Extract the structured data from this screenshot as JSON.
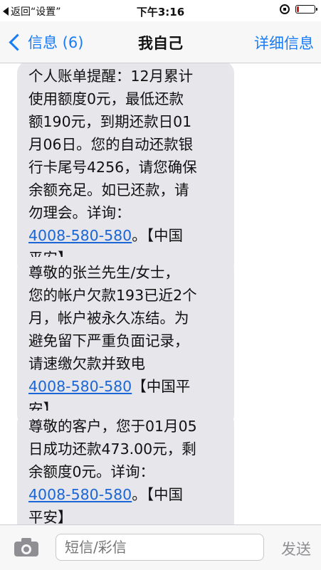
{
  "status_bar": {
    "back_label": "返回“设置”",
    "time": "下午3:16"
  },
  "nav": {
    "back_label": "信息 (6)",
    "title": "我自己",
    "detail_label": "详细信息"
  },
  "messages": [
    {
      "lines": [
        "个人账单提醒：12月累计",
        "使用额度0元，最低还款",
        "额190元，到期还款日01",
        "月06日。您的自动还款银",
        "行卡尾号4256，请您确保",
        "余额充足。如已还款，请",
        "勿理会。详询："
      ],
      "link": "4008-580-580",
      "link_suffix": "。【中国",
      "tail": "平安】"
    },
    {
      "lines": [
        "尊敬的张兰先生/女士，",
        "您的帐户欠款193已近2个",
        "月，帐户被永久冻结。为",
        "避免留下严重负面记录，",
        "请速缴欠款并致电"
      ],
      "link": "4008-580-580",
      "link_suffix": "【中国平",
      "tail": "安】"
    },
    {
      "lines": [
        "尊敬的客户，您于01月05",
        "日成功还款473.00元，剩",
        "余额度0元。详询："
      ],
      "link": "4008-580-580",
      "link_suffix": "。【中国",
      "tail": "平安】"
    }
  ],
  "input_bar": {
    "placeholder": "短信/彩信",
    "send_label": "发送",
    "camera_icon": "camera-icon"
  }
}
